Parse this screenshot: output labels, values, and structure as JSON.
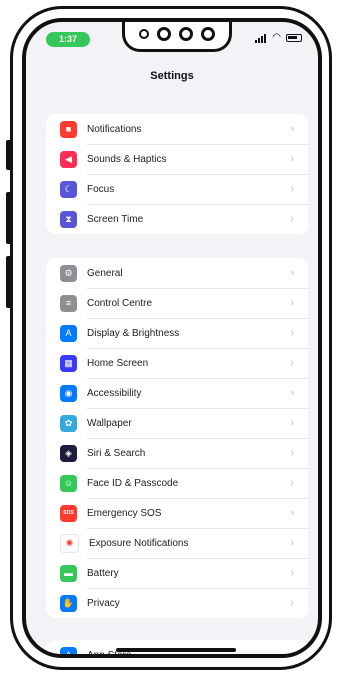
{
  "status_bar": {
    "time": "1:37"
  },
  "nav": {
    "title": "Settings"
  },
  "groups": [
    {
      "items": [
        {
          "label": "Notifications",
          "icon": "bell-icon",
          "color": "#ff3b30",
          "glyph": "■"
        },
        {
          "label": "Sounds & Haptics",
          "icon": "speaker-icon",
          "color": "#ff2d55",
          "glyph": "◀"
        },
        {
          "label": "Focus",
          "icon": "moon-icon",
          "color": "#5856d6",
          "glyph": "☾"
        },
        {
          "label": "Screen Time",
          "icon": "hourglass-icon",
          "color": "#5856d6",
          "glyph": "⧗"
        }
      ]
    },
    {
      "items": [
        {
          "label": "General",
          "icon": "gear-icon",
          "color": "#8e8e93",
          "glyph": "⚙"
        },
        {
          "label": "Control Centre",
          "icon": "toggles-icon",
          "color": "#8e8e93",
          "glyph": "≡"
        },
        {
          "label": "Display & Brightness",
          "icon": "text-size-icon",
          "color": "#007aff",
          "glyph": "A"
        },
        {
          "label": "Home Screen",
          "icon": "grid-icon",
          "color": "#3a3aff",
          "glyph": "▦"
        },
        {
          "label": "Accessibility",
          "icon": "accessibility-icon",
          "color": "#007aff",
          "glyph": "◉"
        },
        {
          "label": "Wallpaper",
          "icon": "flower-icon",
          "color": "#34aadc",
          "glyph": "✿"
        },
        {
          "label": "Siri & Search",
          "icon": "siri-icon",
          "color": "#1c1c3c",
          "glyph": "◈"
        },
        {
          "label": "Face ID & Passcode",
          "icon": "face-id-icon",
          "color": "#34c759",
          "glyph": "☺"
        },
        {
          "label": "Emergency SOS",
          "icon": "sos-icon",
          "color": "#ff3b30",
          "glyph": "SOS"
        },
        {
          "label": "Exposure Notifications",
          "icon": "exposure-icon",
          "color": "#ffffff",
          "glyph": "✺",
          "glyph_color": "#ff3b30"
        },
        {
          "label": "Battery",
          "icon": "battery-icon",
          "color": "#34c759",
          "glyph": "▬"
        },
        {
          "label": "Privacy",
          "icon": "hand-icon",
          "color": "#007aff",
          "glyph": "✋"
        }
      ]
    },
    {
      "items": [
        {
          "label": "App Store",
          "icon": "app-store-icon",
          "color": "#007aff",
          "glyph": "A"
        }
      ]
    }
  ]
}
